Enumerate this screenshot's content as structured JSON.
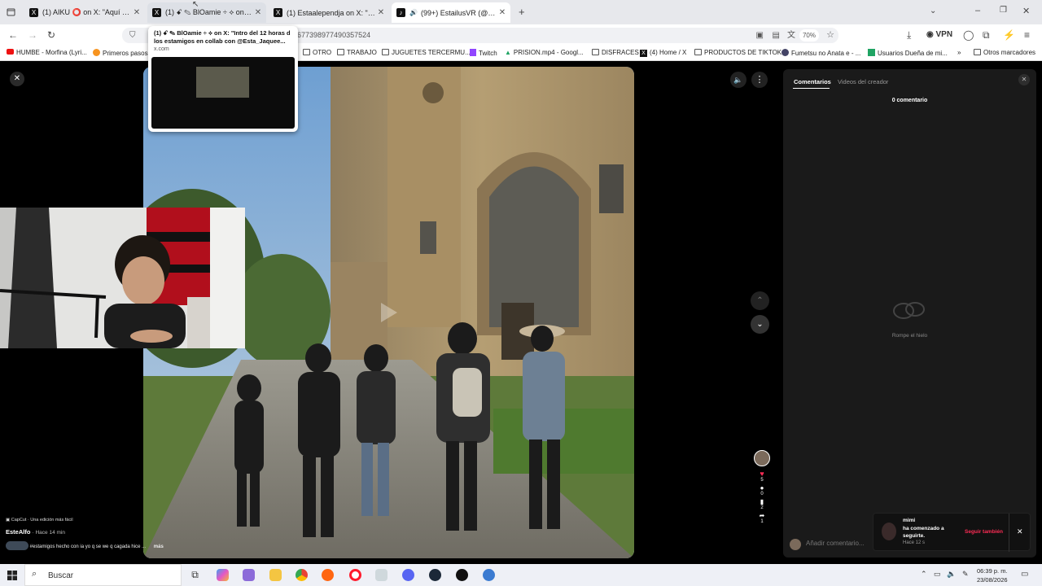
{
  "browser": {
    "tabs": [
      {
        "label": "(1) AIKU ⭕ on X: \"Aquí está mi",
        "favicon": "X"
      },
      {
        "label": "(1) ꗃ ✎ BlOamie ÷ ⟡ on X: \"In",
        "favicon": "X"
      },
      {
        "label": "(1) Estaalependja on X: \"Le cam",
        "favicon": "X"
      },
      {
        "label": "(99+) EstailusVR (@estailus",
        "favicon": "♪"
      }
    ],
    "new_tab_label": "+",
    "url_text": "7677398977490357524",
    "zoom": "70%",
    "vpn_label": "VPN",
    "tooltip": {
      "title": "(1) ꗃ ✎ BlOamie ÷ ⟡ on X: \"Intro del 12 horas d los estamigos en collab con @Esta_Jaquee...",
      "domain": "x.com"
    },
    "bookmarks": [
      "HUMBE - Morfina (Lyri...",
      "Primeros pasos",
      "OTRO",
      "TRABAJO",
      "JUGUETES TERCERMU...",
      "Twitch",
      "PRISION.mp4 - Googl...",
      "DISFRACES",
      "(4) Home / X",
      "PRODUCTOS DE TIKTOK",
      "Fumetsu no Anata e - ...",
      "Usuarios Dueña de mi...",
      "Otros marcadores"
    ]
  },
  "player": {
    "capcut_label": "CapCut · Una edición más fácil",
    "author": "EsteAlfo",
    "time_ago": "· Hace 14 min",
    "caption": "#estamigos hecho con ia yo q se we q cagada hice ...",
    "more_label": "más",
    "counts": {
      "likes": "5",
      "comments": "0",
      "saves": "2",
      "shares": "1"
    }
  },
  "comments_panel": {
    "tab_comments": "Comentarios",
    "tab_creator": "Videos del creador",
    "count_text": "0 comentario",
    "empty_text": "Rompe el hielo",
    "input_placeholder": "Añadir comentario..."
  },
  "notification": {
    "user": "mimi",
    "message": "ha comenzado a seguirte.",
    "time": "Hace 12 s",
    "follow_back": "Seguir también"
  },
  "taskbar": {
    "search_label": "Buscar",
    "time": "06:39 p. m.",
    "date": "23/08/2026"
  },
  "colors": {
    "accent_red": "#fe2c55",
    "panel_bg": "#1a1a1a"
  }
}
